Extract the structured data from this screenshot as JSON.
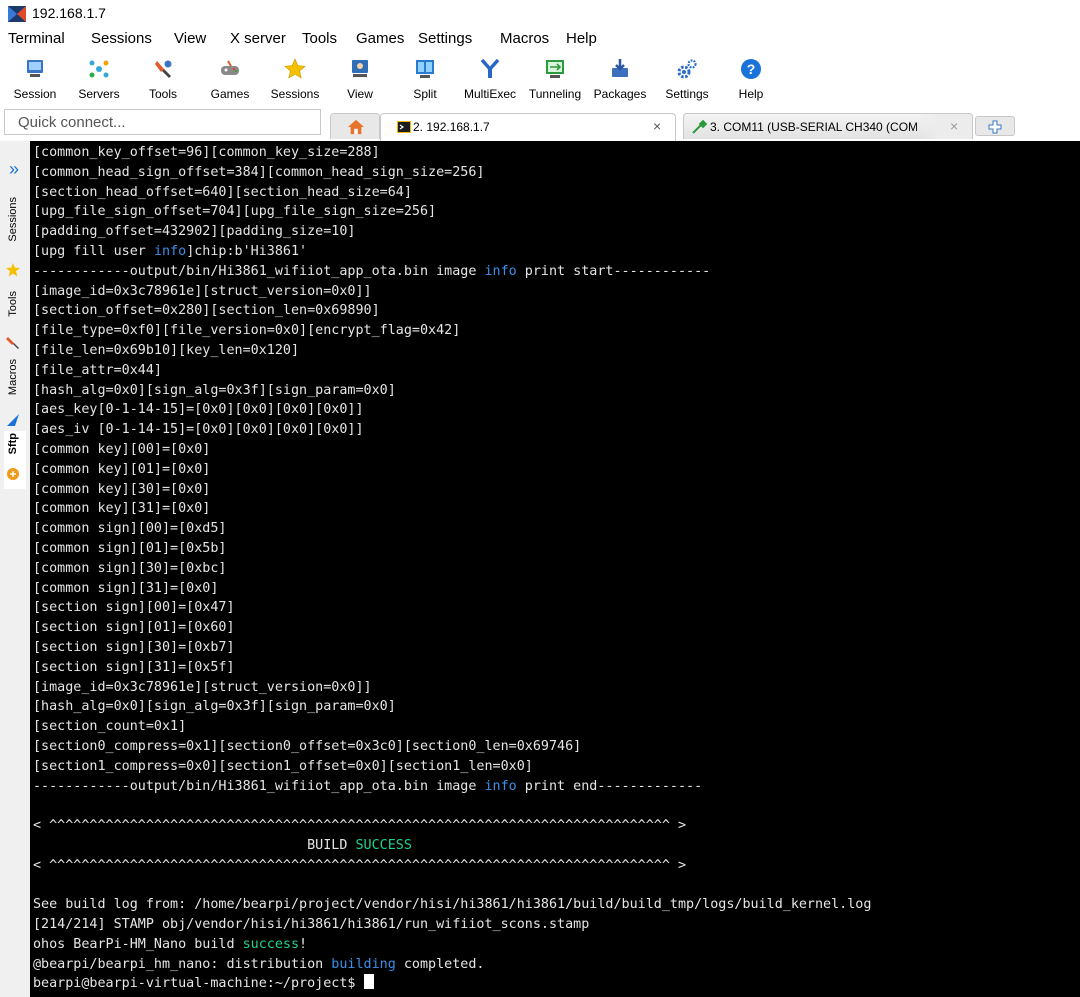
{
  "window": {
    "title": "192.168.1.7"
  },
  "menubar": {
    "items": [
      "Terminal",
      "Sessions",
      "View",
      "X server",
      "Tools",
      "Games",
      "Settings",
      "Macros",
      "Help"
    ]
  },
  "toolbar": {
    "items": [
      {
        "label": "Session",
        "icon": "session-icon",
        "color": "#3a74c4"
      },
      {
        "label": "Servers",
        "icon": "servers-icon",
        "color": "#35a8d8"
      },
      {
        "label": "Tools",
        "icon": "tools-icon",
        "color": "#e05a2b"
      },
      {
        "label": "Games",
        "icon": "games-icon",
        "color": "#777777"
      },
      {
        "label": "Sessions",
        "icon": "star-icon",
        "color": "#f5c000"
      },
      {
        "label": "View",
        "icon": "view-icon",
        "color": "#2f6fb7"
      },
      {
        "label": "Split",
        "icon": "split-icon",
        "color": "#2a7bd0"
      },
      {
        "label": "MultiExec",
        "icon": "multiexec-icon",
        "color": "#2a66c8"
      },
      {
        "label": "Tunneling",
        "icon": "tunneling-icon",
        "color": "#2b9a3e"
      },
      {
        "label": "Packages",
        "icon": "packages-icon",
        "color": "#3c6fc0"
      },
      {
        "label": "Settings",
        "icon": "settings-gear-icon",
        "color": "#2a6cc7"
      },
      {
        "label": "Help",
        "icon": "help-icon",
        "color": "#1a73d9"
      }
    ]
  },
  "quick_connect": {
    "placeholder": "Quick connect..."
  },
  "tabs": [
    {
      "label": "2. 192.168.1.7",
      "active": true,
      "close": "×"
    },
    {
      "label": "3. COM11  (USB-SERIAL CH340 (COM",
      "active": false,
      "close": "×"
    }
  ],
  "side_panel": {
    "expand": "»",
    "tabs": [
      "Sessions",
      "Tools",
      "Macros",
      "Sftp"
    ]
  },
  "terminal": {
    "lines": [
      [
        {
          "t": "[common_key_offset=96][common_key_size=288]"
        }
      ],
      [
        {
          "t": "[common_head_sign_offset=384][common_head_sign_size=256]"
        }
      ],
      [
        {
          "t": "[section_head_offset=640][section_head_size=64]"
        }
      ],
      [
        {
          "t": "[upg_file_sign_offset=704][upg_file_sign_size=256]"
        }
      ],
      [
        {
          "t": "[padding_offset=432902][padding_size=10]"
        }
      ],
      [
        {
          "t": "[upg fill user "
        },
        {
          "t": "info",
          "c": "hl"
        },
        {
          "t": "]chip:b'Hi3861'"
        }
      ],
      [
        {
          "t": "------------output/bin/Hi3861_wifiiot_app_ota.bin image "
        },
        {
          "t": "info",
          "c": "hl"
        },
        {
          "t": " print start------------"
        }
      ],
      [
        {
          "t": "[image_id=0x3c78961e][struct_version=0x0]]"
        }
      ],
      [
        {
          "t": "[section_offset=0x280][section_len=0x69890]"
        }
      ],
      [
        {
          "t": "[file_type=0xf0][file_version=0x0][encrypt_flag=0x42]"
        }
      ],
      [
        {
          "t": "[file_len=0x69b10][key_len=0x120]"
        }
      ],
      [
        {
          "t": "[file_attr=0x44]"
        }
      ],
      [
        {
          "t": "[hash_alg=0x0][sign_alg=0x3f][sign_param=0x0]"
        }
      ],
      [
        {
          "t": "[aes_key[0-1-14-15]=[0x0][0x0][0x0][0x0]]"
        }
      ],
      [
        {
          "t": "[aes_iv [0-1-14-15]=[0x0][0x0][0x0][0x0]]"
        }
      ],
      [
        {
          "t": "[common key][00]=[0x0]"
        }
      ],
      [
        {
          "t": "[common key][01]=[0x0]"
        }
      ],
      [
        {
          "t": "[common key][30]=[0x0]"
        }
      ],
      [
        {
          "t": "[common key][31]=[0x0]"
        }
      ],
      [
        {
          "t": "[common sign][00]=[0xd5]"
        }
      ],
      [
        {
          "t": "[common sign][01]=[0x5b]"
        }
      ],
      [
        {
          "t": "[common sign][30]=[0xbc]"
        }
      ],
      [
        {
          "t": "[common sign][31]=[0x0]"
        }
      ],
      [
        {
          "t": "[section sign][00]=[0x47]"
        }
      ],
      [
        {
          "t": "[section sign][01]=[0x60]"
        }
      ],
      [
        {
          "t": "[section sign][30]=[0xb7]"
        }
      ],
      [
        {
          "t": "[section sign][31]=[0x5f]"
        }
      ],
      [
        {
          "t": "[image_id=0x3c78961e][struct_version=0x0]]"
        }
      ],
      [
        {
          "t": "[hash_alg=0x0][sign_alg=0x3f][sign_param=0x0]"
        }
      ],
      [
        {
          "t": "[section_count=0x1]"
        }
      ],
      [
        {
          "t": "[section0_compress=0x1][section0_offset=0x3c0][section0_len=0x69746]"
        }
      ],
      [
        {
          "t": "[section1_compress=0x0][section1_offset=0x0][section1_len=0x0]"
        }
      ],
      [
        {
          "t": "------------output/bin/Hi3861_wifiiot_app_ota.bin image "
        },
        {
          "t": "info",
          "c": "hl"
        },
        {
          "t": " print end-------------"
        }
      ],
      [
        {
          "t": ""
        }
      ],
      [
        {
          "t": "< ^^^^^^^^^^^^^^^^^^^^^^^^^^^^^^^^^^^^^^^^^^^^^^^^^^^^^^^^^^^^^^^^^^^^^^^^^^^^^ >"
        }
      ],
      [
        {
          "t": "                                  BUILD "
        },
        {
          "t": "SUCCESS",
          "c": "ok"
        }
      ],
      [
        {
          "t": "< ^^^^^^^^^^^^^^^^^^^^^^^^^^^^^^^^^^^^^^^^^^^^^^^^^^^^^^^^^^^^^^^^^^^^^^^^^^^^^ >"
        }
      ],
      [
        {
          "t": ""
        }
      ],
      [
        {
          "t": "See build log from: /home/bearpi/project/vendor/hisi/hi3861/hi3861/build/build_tmp/logs/build_kernel.log"
        }
      ],
      [
        {
          "t": "[214/214] STAMP obj/vendor/hisi/hi3861/hi3861/run_wifiiot_scons.stamp"
        }
      ],
      [
        {
          "t": "ohos BearPi-HM_Nano build "
        },
        {
          "t": "success",
          "c": "ok"
        },
        {
          "t": "!"
        }
      ],
      [
        {
          "t": "@bearpi/bearpi_hm_nano: distribution "
        },
        {
          "t": "building",
          "c": "hl"
        },
        {
          "t": " completed."
        }
      ],
      [
        {
          "t": "bearpi@bearpi-virtual-machine:~/project$ "
        },
        {
          "t": "",
          "c": "cursor"
        }
      ]
    ]
  },
  "colors": {
    "terminal_bg": "#000000",
    "terminal_fg": "#e5e5e5",
    "info_blue": "#3b8eea",
    "success_green": "#23d18b"
  }
}
